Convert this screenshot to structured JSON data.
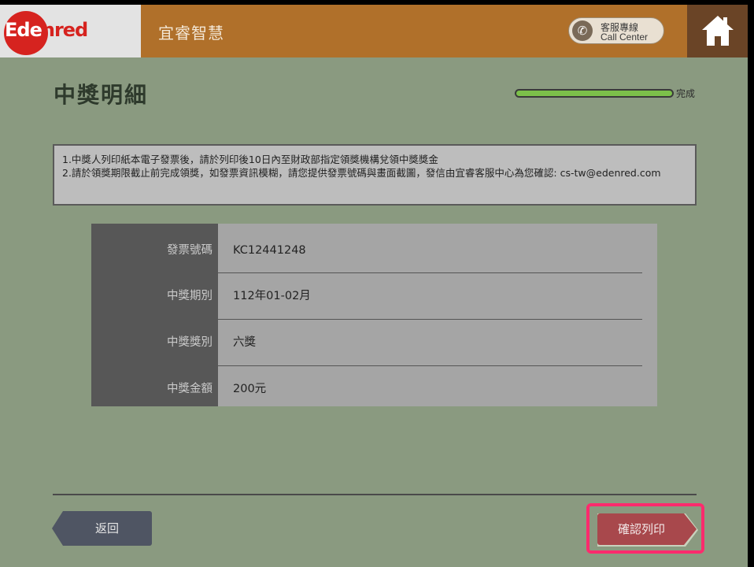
{
  "header": {
    "logo_text_white": "Ede",
    "logo_text_red": "nred",
    "brand_title": "宜睿智慧",
    "call_center_zh": "客服專線",
    "call_center_en": "Call Center",
    "call_icon": "phone-icon",
    "home_icon": "home-icon"
  },
  "page": {
    "title": "中獎明細",
    "progress_label": "完成",
    "progress_fraction": 1.0
  },
  "notice": {
    "line1": "1.中獎人列印紙本電子發票後，請於列印後10日內至財政部指定領獎機構兌領中獎獎金",
    "line2": "2.請於領獎期限截止前完成領獎，如發票資訊模糊，請您提供發票號碼與畫面截圖，發信由宜睿客服中心為您確認: cs-tw@edenred.com"
  },
  "details": [
    {
      "label": "發票號碼",
      "value": "KC12441248"
    },
    {
      "label": "中獎期別",
      "value": "112年01-02月"
    },
    {
      "label": "中獎獎別",
      "value": "六獎"
    },
    {
      "label": "中獎金額",
      "value": "200元"
    }
  ],
  "footer": {
    "back_label": "返回",
    "confirm_label": "確認列印"
  },
  "colors": {
    "background": "#8a9a80",
    "brand_bar": "#b0702a",
    "home_box": "#6a4426",
    "confirm_button": "#a8484c",
    "back_button": "#4f5563",
    "highlight": "#ff2a6d",
    "progress": "#7cc04a"
  }
}
